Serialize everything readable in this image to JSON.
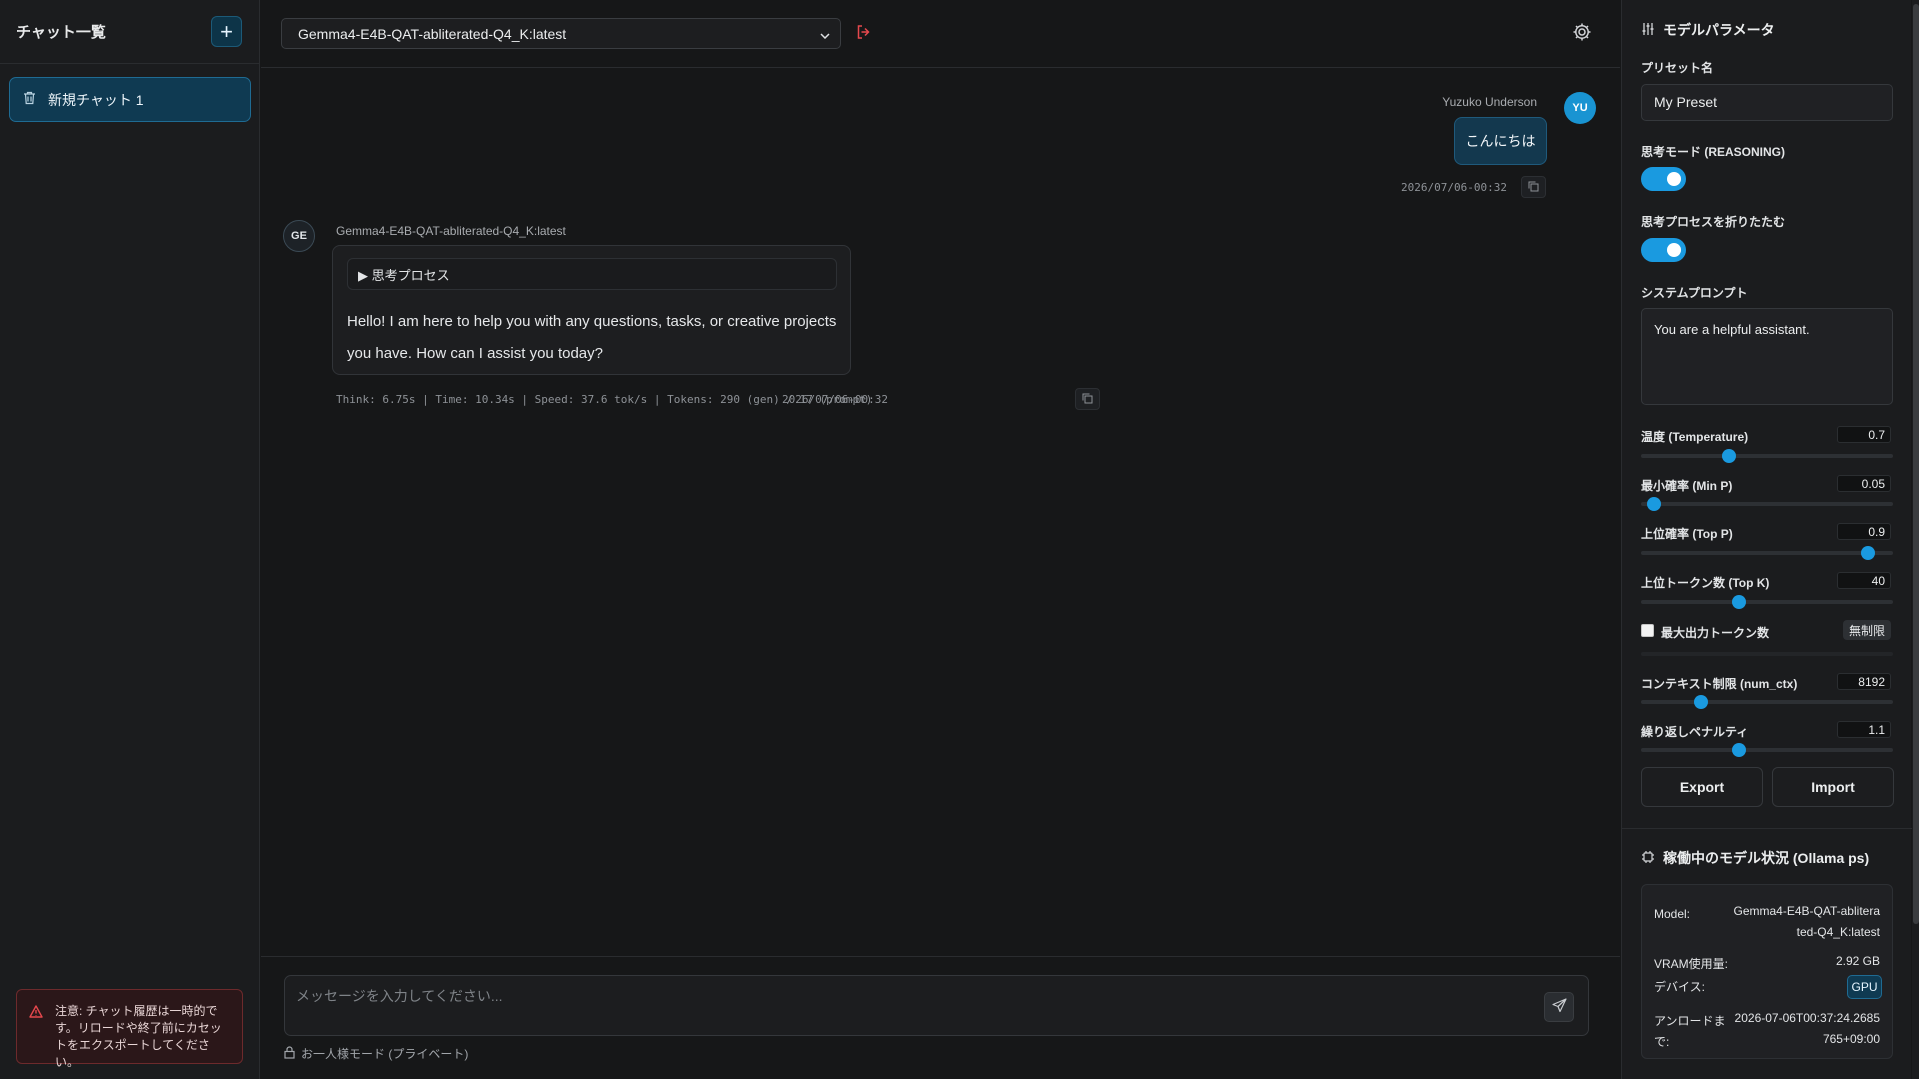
{
  "sidebar": {
    "title": "チャット一覧",
    "new_chat_symbol": "+",
    "chats": [
      {
        "label": "新規チャット 1",
        "icon": "trash-icon"
      }
    ],
    "warning": "注意: チャット履歴は一時的です。リロードや終了前にカセットをエクスポートしてください。"
  },
  "header": {
    "model": "Gemma4-E4B-QAT-abliterated-Q4_K:latest"
  },
  "conversation": {
    "user": {
      "name": "Yuzuko Underson",
      "initials": "YU",
      "message": "こんにちは",
      "timestamp": "2026/07/06-00:32"
    },
    "assistant": {
      "name": "Gemma4-E4B-QAT-abliterated-Q4_K:latest",
      "initials": "GE",
      "thinking_label": "▶ 思考プロセス",
      "message": "Hello! I am here to help you with any questions, tasks, or creative projects you have. How can I assist you today?",
      "stats": "Think: 6.75s | Time: 10.34s | Speed: 37.6 tok/s | Tokens: 290 (gen) / 17 (prompt)",
      "timestamp": "2026/07/06-00:32"
    }
  },
  "composer": {
    "placeholder": "メッセージを入力してください...",
    "private_mode": "お一人様モード (プライベート)"
  },
  "params": {
    "title": "モデルパラメータ",
    "preset_label": "プリセット名",
    "preset_value": "My Preset",
    "reasoning_label": "思考モード (REASONING)",
    "reasoning_on": true,
    "fold_label": "思考プロセスを折りたたむ",
    "fold_on": true,
    "system_prompt_label": "システムプロンプト",
    "system_prompt": "You are a helpful assistant.",
    "temperature": {
      "label": "温度 (Temperature)",
      "value": "0.7",
      "fraction": 0.35
    },
    "min_p": {
      "label": "最小確率 (Min P)",
      "value": "0.05",
      "fraction": 0.05
    },
    "top_p": {
      "label": "上位確率 (Top P)",
      "value": "0.9",
      "fraction": 0.9
    },
    "top_k": {
      "label": "上位トークン数 (Top K)",
      "value": "40",
      "fraction": 0.39
    },
    "max_tokens": {
      "label": "最大出力トークン数",
      "badge": "無制限",
      "checked": false
    },
    "num_ctx": {
      "label": "コンテキスト制限 (num_ctx)",
      "value": "8192",
      "fraction": 0.24
    },
    "repeat_penalty": {
      "label": "繰り返しペナルティ",
      "value": "1.1",
      "fraction": 0.39
    },
    "export_label": "Export",
    "import_label": "Import"
  },
  "status": {
    "title": "稼働中のモデル状況 (Ollama ps)",
    "model_key": "Model:",
    "model_value_1": "Gemma4-E4B-QAT-ablitera",
    "model_value_2": "ted-Q4_K:latest",
    "vram_key": "VRAM使用量:",
    "vram_value": "2.92 GB",
    "device_key": "デバイス:",
    "device_value": "GPU",
    "unload_key_1": "アンロードま",
    "unload_key_2": "で:",
    "unload_value_1": "2026-07-06T00:37:24.2685",
    "unload_value_2": "765+09:00"
  },
  "colors": {
    "accent": "#1a9ae0",
    "warning": "#e5484d"
  }
}
